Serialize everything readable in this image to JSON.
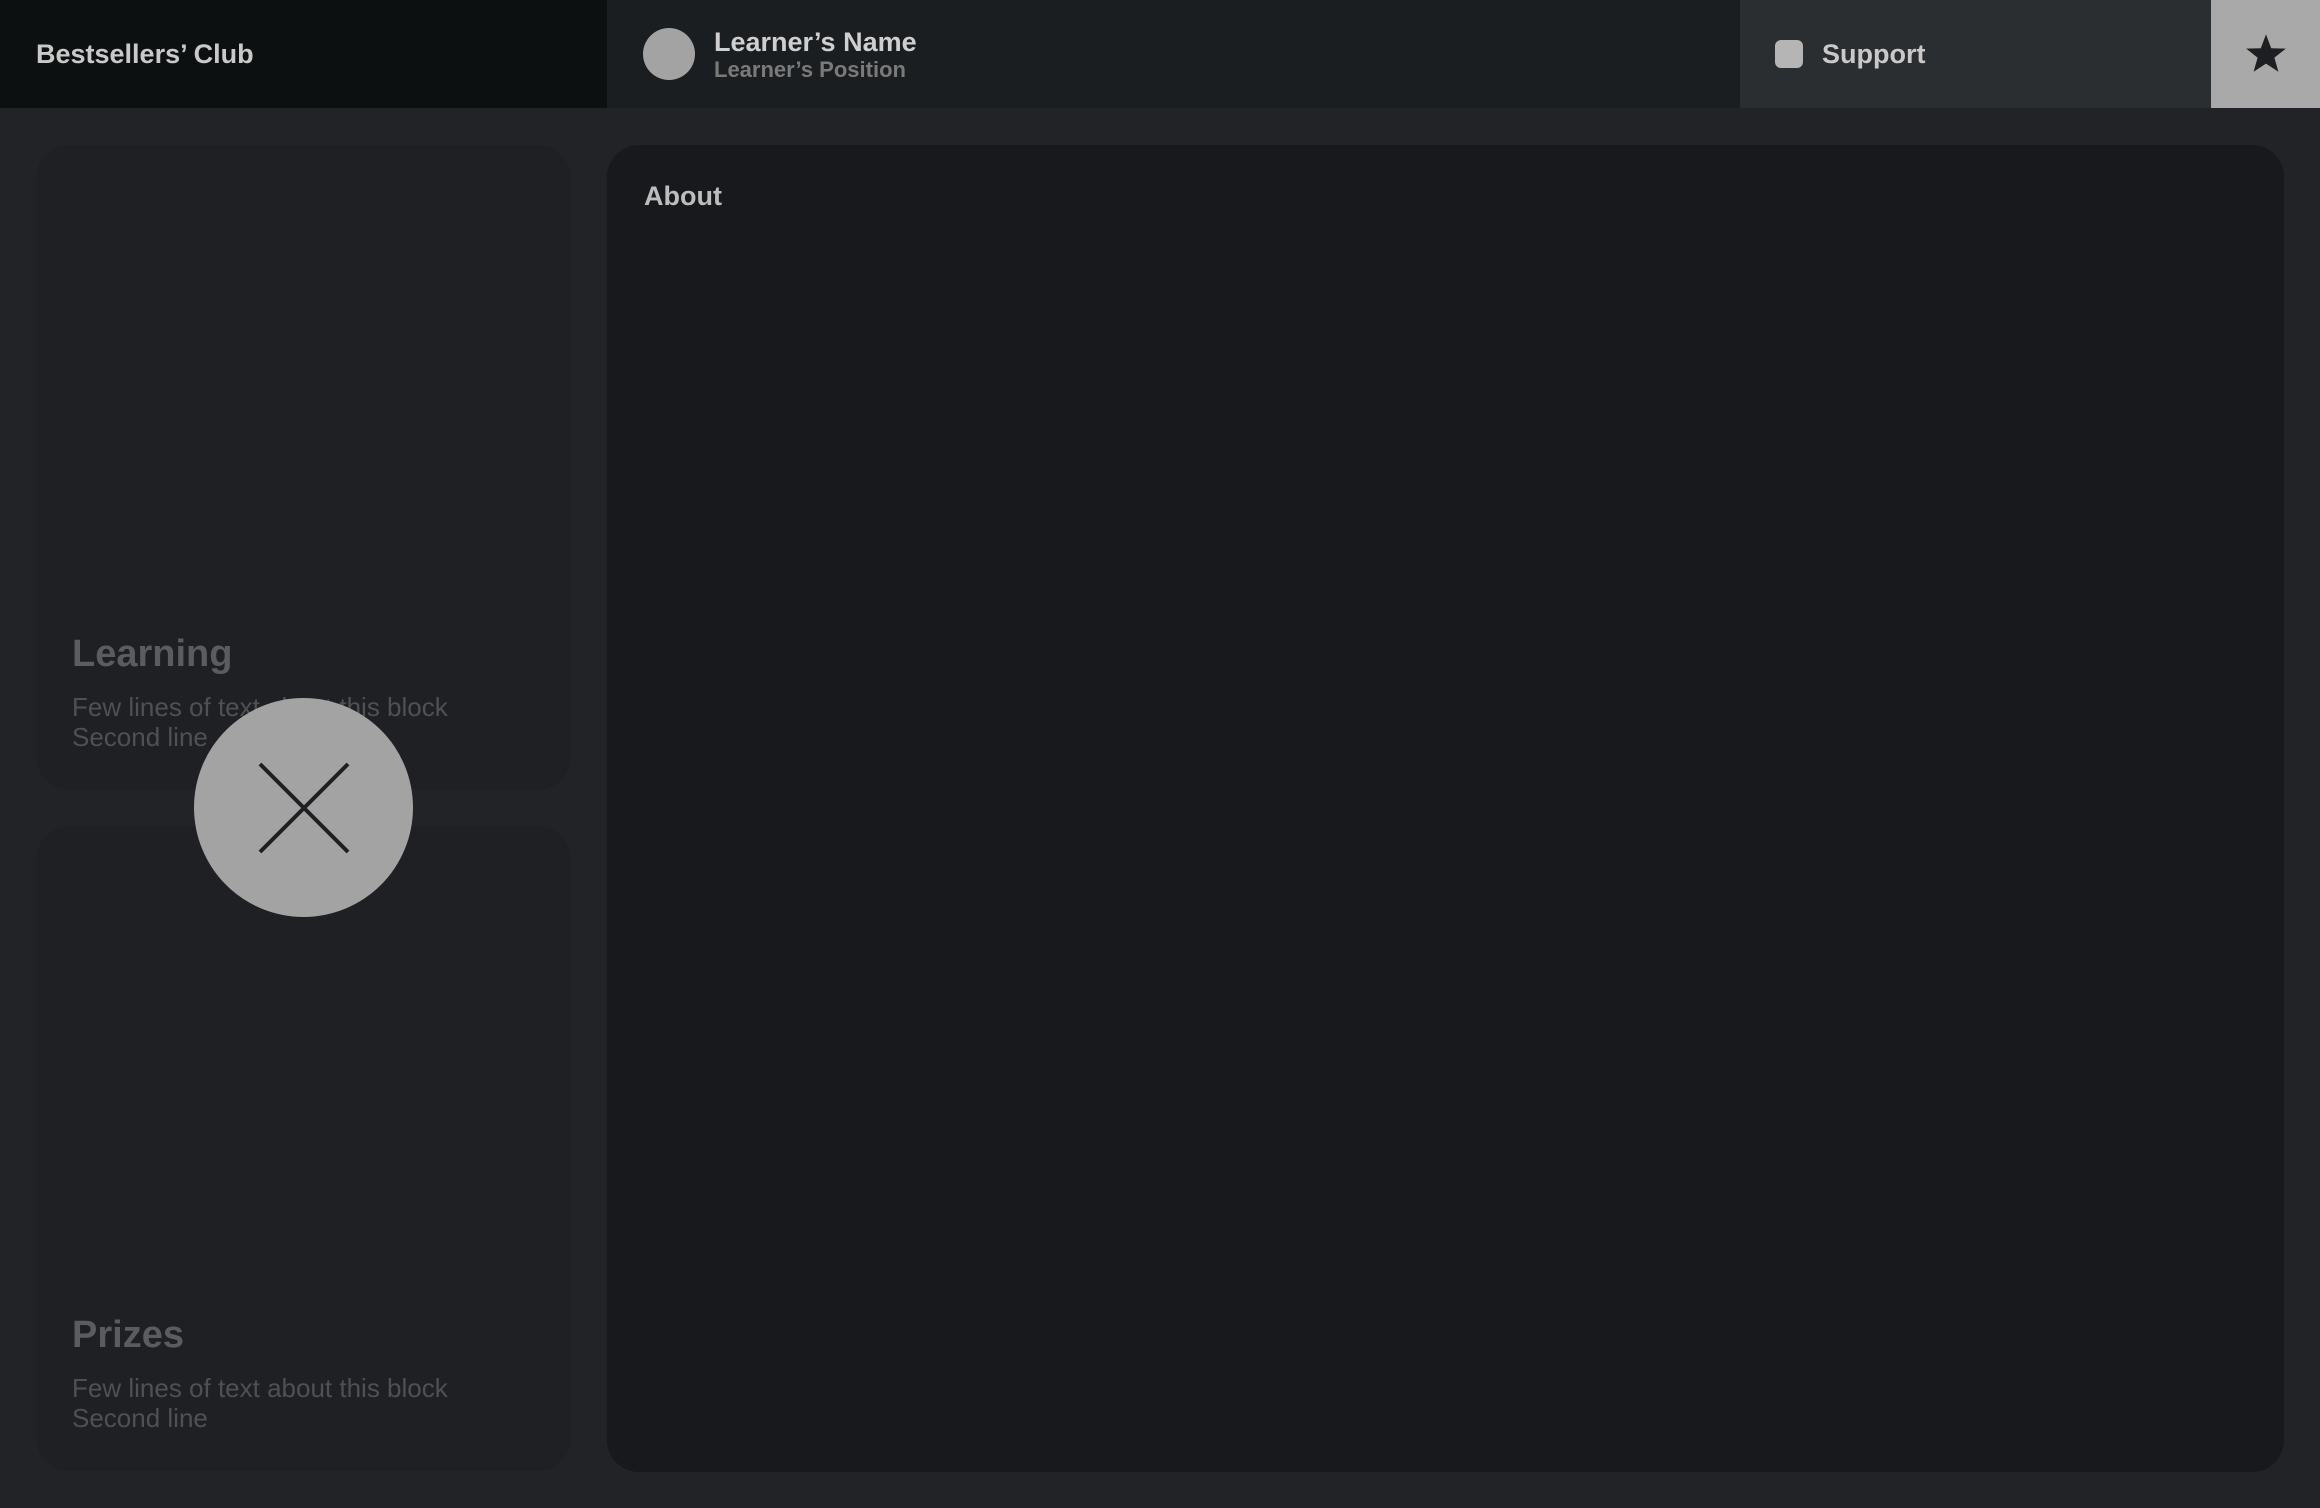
{
  "header": {
    "brand_title": "Bestsellers’ Club",
    "learner_name": "Learner’s Name",
    "learner_position": "Learner’s  Position",
    "support_label": "Support",
    "star_icon": "star-icon",
    "support_icon": "square-icon"
  },
  "cards": [
    {
      "title": "Learning",
      "line1": "Few lines of text about this block",
      "line2": "Second line"
    },
    {
      "title": "Prizes",
      "line1": "Few lines of text about this block",
      "line2": "Second line"
    }
  ],
  "main": {
    "title": "About"
  },
  "overlay": {
    "close_icon": "close-icon"
  },
  "colors": {
    "background": "#222326",
    "brand_bar": "#0d1011",
    "learner_bar": "#1b1e21",
    "support_bar": "#2b2e31",
    "star_button": "#a9a9a9",
    "card": "#1f2023",
    "main_panel": "#18191c",
    "close_button": "#a3a3a3"
  }
}
